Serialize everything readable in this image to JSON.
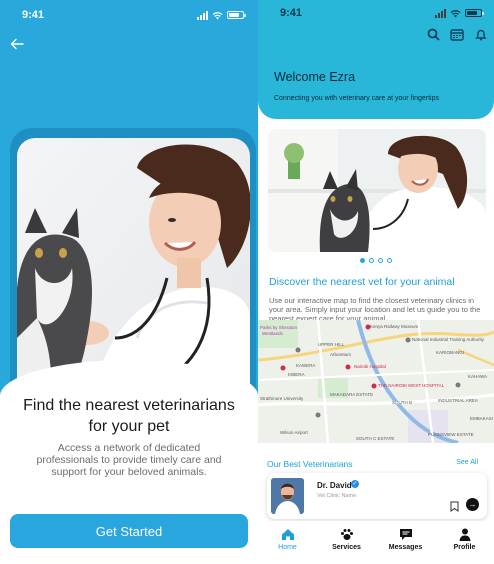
{
  "left": {
    "status_time": "9:41",
    "title_line1": "Find the nearest veterinarians",
    "title_line2": "for your pet",
    "description": "Access a network of dedicated professionals to provide timely care and support for your beloved animals.",
    "cta_label": "Get Started"
  },
  "right": {
    "status_time": "9:41",
    "welcome": "Welcome Ezra",
    "subtitle": "Connecting you with veterinary care at your fingertips",
    "carousel": {
      "count": 4,
      "active": 0
    },
    "discover_title": "Discover the nearest vet for your animal",
    "discover_desc": "Use our interactive map to find the closest veterinary clinics in your area. Simply input your location and let us guide you to the nearest expert care for your animal.",
    "map_labels": {
      "l1": "Parks by Sheraton",
      "l2": "Westlands",
      "l3": "Kenya Railway Museum",
      "l4": "UPPER HILL",
      "l5": "National Industrial Training Authority",
      "l6": "KARIOBANGI",
      "l7": "Nairobi Hospital",
      "l8": "KAWERA",
      "l9": "KIBERA",
      "l10": "Arboretum",
      "l11": "MAKADARA ESTATE",
      "l12": "THE NAIROBI WEST HOSPITAL",
      "l13": "SOUTH B",
      "l14": "Strathmore University",
      "l15": "INDUSTRIAL AREA",
      "l16": "Wilson Airport",
      "l17": "SOUTH C ESTATE",
      "l18": "EMBAKASI",
      "l19": "PLAINSVIEW ESTATE",
      "l20": "KAHAWA"
    },
    "vets_heading": "Our Best Veterinarians",
    "see_all": "See All",
    "vet": {
      "name": "Dr. David",
      "clinic": "Vet Clinic Name"
    },
    "tabs": [
      {
        "label": "Home",
        "icon": "home-icon",
        "active": true
      },
      {
        "label": "Services",
        "icon": "paw-icon",
        "active": false
      },
      {
        "label": "Messages",
        "icon": "message-icon",
        "active": false
      },
      {
        "label": "Profile",
        "icon": "person-icon",
        "active": false
      }
    ]
  },
  "colors": {
    "primary": "#29a8dc",
    "header": "#29b7d9",
    "accent_text": "#1e9fd6"
  }
}
